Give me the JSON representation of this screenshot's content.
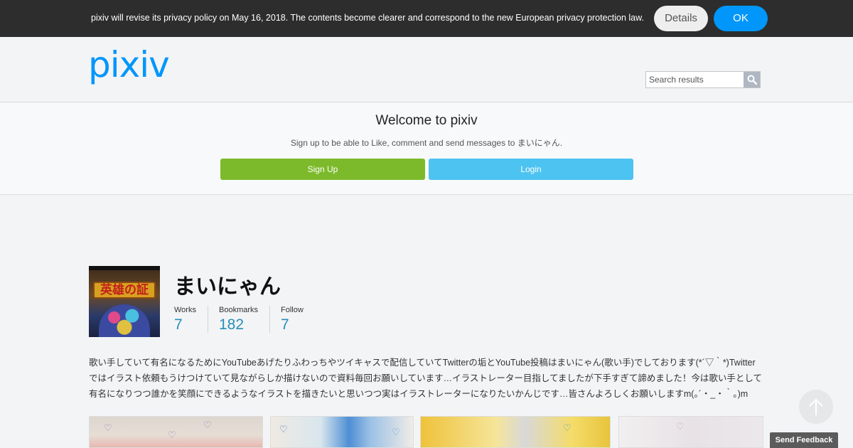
{
  "notice": {
    "text": "pixiv will revise its privacy policy on May 16, 2018. The contents become clearer and correspond to the new European privacy protection law.",
    "details_label": "Details",
    "ok_label": "OK"
  },
  "header": {
    "logo_text": "pixiv",
    "search_placeholder": "Search results",
    "search_icon": "search-icon"
  },
  "welcome": {
    "title": "Welcome to pixiv",
    "subtitle": "Sign up to be able to Like, comment and send messages to まいにゃん.",
    "signup_label": "Sign Up",
    "login_label": "Login"
  },
  "profile": {
    "avatar_text": "英雄の証",
    "name": "まいにゃん",
    "stats": [
      {
        "label": "Works",
        "value": "7"
      },
      {
        "label": "Bookmarks",
        "value": "182"
      },
      {
        "label": "Follow",
        "value": "7"
      }
    ],
    "bio": "歌い手していて有名になるためにYouTubeあげたりふわっちやツイキャスで配信していてTwitterの垢とYouTube投稿はまいにゃん(歌い手)でしております(*´▽｀*)Twitterではイラスト依頼もうけつけていて見ながらしか描けないので資料毎回お願いしています…イラストレーター目指してましたが下手すぎて諦めました！今は歌い手として有名になりつつ誰かを笑顔にできるようなイラストを描きたいと思いつつ実はイラストレーターになりたいかんじです…皆さんよろしくお願いしますm(｡´・_・｀｡)m"
  },
  "works": {
    "thumbnails": [
      "artwork-1",
      "artwork-2",
      "artwork-3",
      "artwork-4"
    ]
  },
  "footer": {
    "scroll_top_icon": "arrow-up-icon",
    "feedback_label": "Send Feedback"
  },
  "colors": {
    "brand": "#0096fa",
    "signup": "#7cba2b",
    "login": "#4dc3f1",
    "stat_value": "#258fb8",
    "notice_bg": "#2d2d2d"
  }
}
